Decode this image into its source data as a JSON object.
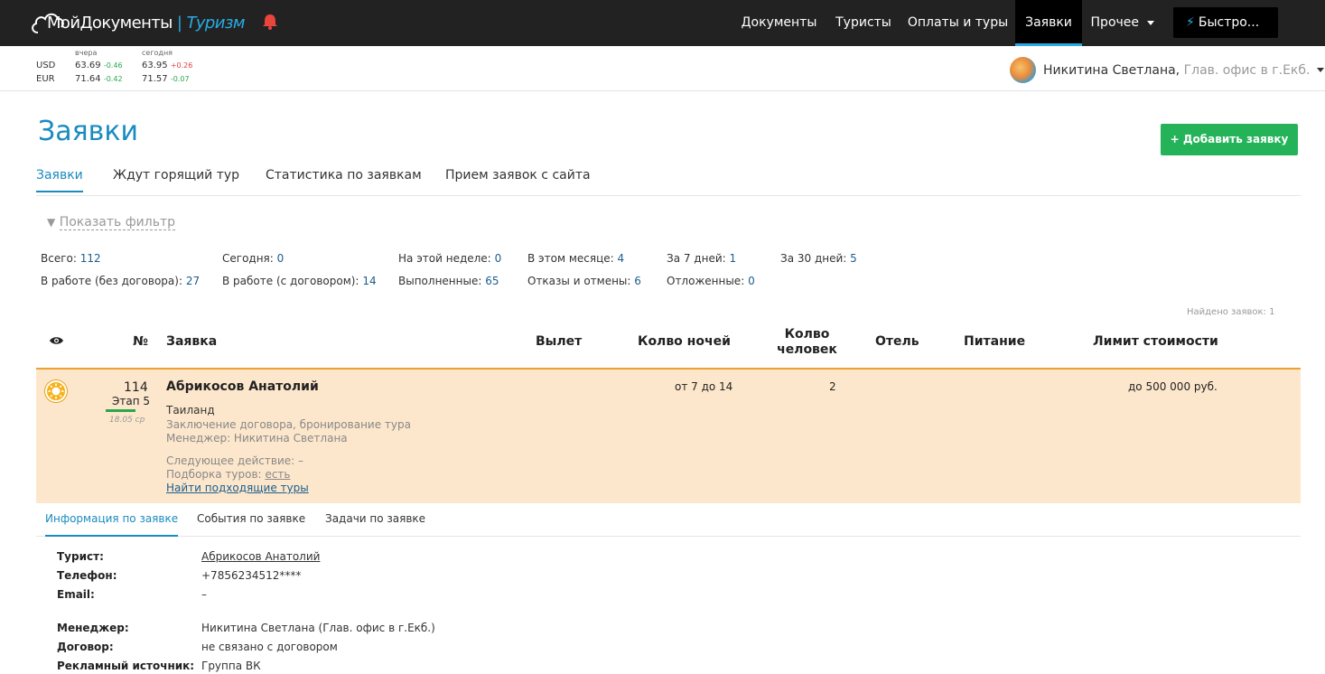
{
  "app": {
    "logo_main": "МойДокументы",
    "logo_sep": "|",
    "logo_sub": "Туризм"
  },
  "nav": {
    "items": [
      "Документы",
      "Туристы",
      "Оплаты и туры",
      "Заявки",
      "Прочее"
    ],
    "active": "Заявки",
    "quick_label": "Быстро..."
  },
  "rates": {
    "yesterday_label": "вчера",
    "today_label": "сегодня",
    "usd": {
      "code": "USD",
      "yesterday": "63.69",
      "y_delta": "-0.46",
      "today": "63.95",
      "t_delta": "+0.26"
    },
    "eur": {
      "code": "EUR",
      "yesterday": "71.64",
      "y_delta": "-0.42",
      "today": "71.57",
      "t_delta": "-0.07"
    }
  },
  "user": {
    "name": "Никитина Светлана,",
    "office": "Глав. офис в г.Екб."
  },
  "page": {
    "title": "Заявки",
    "add_button": "+ Добавить заявку",
    "tabs": [
      "Заявки",
      "Ждут горящий тур",
      "Статистика по заявкам",
      "Прием заявок с сайта"
    ],
    "filter": "Показать фильтр",
    "found": "Найдено заявок: 1"
  },
  "stats": {
    "total": {
      "label": "Всего:",
      "value": "112"
    },
    "today": {
      "label": "Сегодня:",
      "value": "0"
    },
    "week": {
      "label": "На этой неделе:",
      "value": "0"
    },
    "month": {
      "label": "В этом месяце:",
      "value": "4"
    },
    "d7": {
      "label": "За 7 дней:",
      "value": "1"
    },
    "d30": {
      "label": "За 30 дней:",
      "value": "5"
    },
    "work_no_contract": {
      "label": "В работе (без договора):",
      "value": "27"
    },
    "work_contract": {
      "label": "В работе (с договором):",
      "value": "14"
    },
    "done": {
      "label": "Выполненные:",
      "value": "65"
    },
    "refused": {
      "label": "Отказы и отмены:",
      "value": "6"
    },
    "postponed": {
      "label": "Отложенные:",
      "value": "0"
    }
  },
  "table": {
    "headers": {
      "num": "№",
      "request": "Заявка",
      "departure": "Вылет",
      "nights": "Колво ночей",
      "people_1": "Колво",
      "people_2": "человек",
      "hotel": "Отель",
      "meal": "Питание",
      "limit": "Лимит стоимости"
    },
    "row": {
      "number": "114",
      "stage": "Этап 5",
      "date": "18.05 ср",
      "name": "Абрикосов Анатолий",
      "country": "Таиланд",
      "status": "Заключение договора, бронирование тура",
      "manager": "Менеджер: Никитина Светлана",
      "next_action": "Следующее действие: –",
      "selection_label": "Подборка туров:",
      "selection_value": "есть",
      "find_link": "Найти подходящие туры",
      "nights": "от 7 до 14",
      "people": "2",
      "limit": "до 500 000 руб."
    }
  },
  "detail": {
    "tabs": [
      "Информация по заявке",
      "События по заявке",
      "Задачи по заявке"
    ],
    "tourist_label": "Турист:",
    "tourist_value": "Абрикосов Анатолий",
    "phone_label": "Телефон:",
    "phone_value": "+7856234512****",
    "email_label": "Email:",
    "email_value": "–",
    "manager_label": "Менеджер:",
    "manager_value": "Никитина Светлана (Глав. офис в г.Екб.)",
    "contract_label": "Договор:",
    "contract_value": "не связано с договором",
    "source_label": "Рекламный источник:",
    "source_value": "Группа ВК"
  }
}
